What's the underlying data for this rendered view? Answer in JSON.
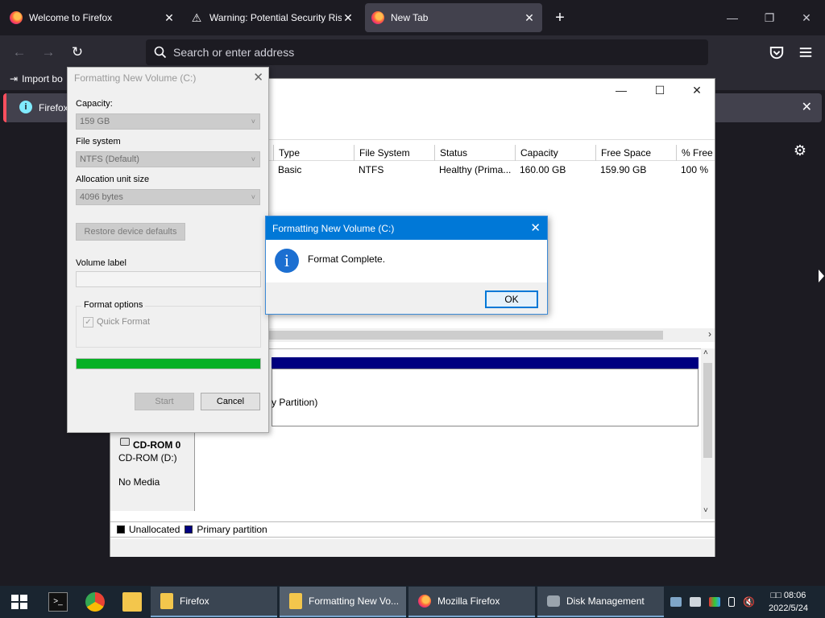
{
  "browser": {
    "tabs": [
      {
        "title": "Welcome to Firefox",
        "close": "✕"
      },
      {
        "title": "Warning: Potential Security Risk",
        "close": "✕"
      },
      {
        "title": "New Tab",
        "close": "✕"
      }
    ],
    "new_tab": "+",
    "window_controls": {
      "minimize": "—",
      "restore": "❐",
      "close": "✕"
    },
    "nav": {
      "back": "←",
      "forward": "→",
      "reload": "↻"
    },
    "address_placeholder": "Search or enter address",
    "bookmarks": {
      "import_label": "Import bo"
    },
    "notification": {
      "label": "Firefox",
      "close": "✕"
    },
    "settings_icon": "⚙"
  },
  "disk_management": {
    "columns": [
      "Type",
      "File System",
      "Status",
      "Capacity",
      "Free Space",
      "% Free"
    ],
    "row": [
      "Basic",
      "NTFS",
      "Healthy (Prima...",
      "160.00 GB",
      "159.90 GB",
      "100 %"
    ],
    "partition_label": "y Partition)",
    "cdrom": {
      "name": "CD-ROM 0",
      "drive": "CD-ROM (D:)",
      "media": "No Media"
    },
    "legend": [
      {
        "label": "Unallocated",
        "color": "#000000"
      },
      {
        "label": "Primary partition",
        "color": "#000080"
      }
    ]
  },
  "format_dialog": {
    "title": "Formatting New Volume (C:)",
    "capacity_label": "Capacity:",
    "capacity_value": "159 GB",
    "fs_label": "File system",
    "fs_value": "NTFS (Default)",
    "alloc_label": "Allocation unit size",
    "alloc_value": "4096 bytes",
    "restore_button": "Restore device defaults",
    "volume_label": "Volume label",
    "format_options_label": "Format options",
    "quick_format_label": "Quick Format",
    "quick_format_checked": true,
    "progress": 1.0,
    "start_button": "Start",
    "cancel_button": "Cancel"
  },
  "message_box": {
    "title": "Formatting New Volume (C:)",
    "message": "Format Complete.",
    "ok_button": "OK",
    "icon_glyph": "i"
  },
  "taskbar": {
    "tasks": [
      {
        "label": "Firefox"
      },
      {
        "label": "Formatting New Vo..."
      },
      {
        "label": "Mozilla Firefox"
      },
      {
        "label": "Disk Management"
      }
    ],
    "clock_time": "□□ 08:06",
    "clock_date": "2022/5/24"
  },
  "colors": {
    "accent_blue": "#0078d7",
    "progress_green": "#06b025",
    "primary_partition": "#000080"
  }
}
